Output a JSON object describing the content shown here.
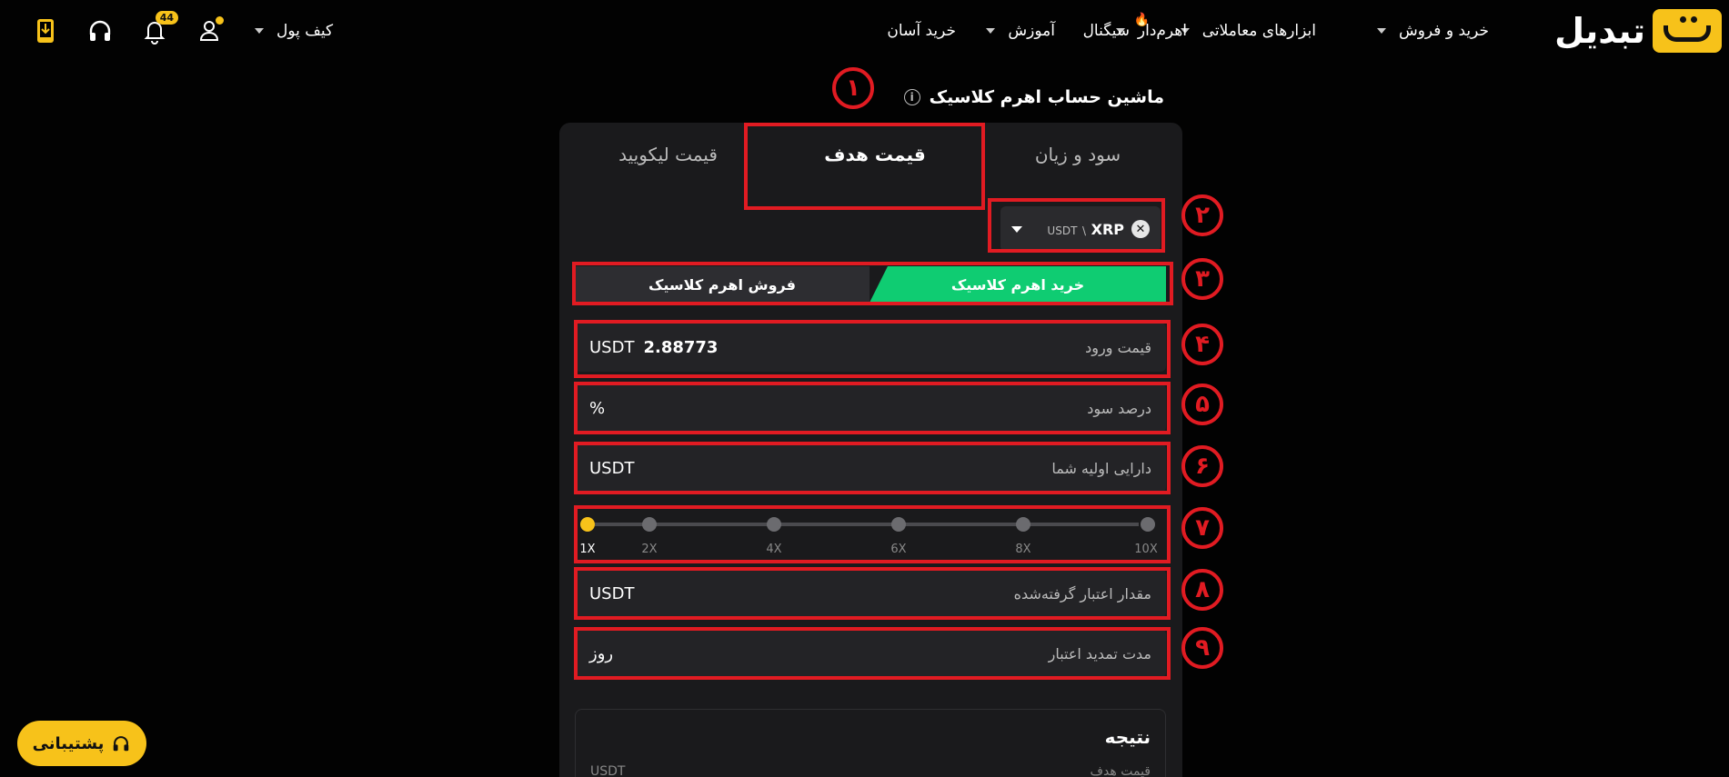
{
  "header": {
    "logo_text": "تبدیل",
    "nav": [
      {
        "label": "خرید و فروش",
        "dropdown": true
      },
      {
        "label": "ابزارهای معاملاتی",
        "dropdown": true
      },
      {
        "label": "اهرم‌دار",
        "dropdown": true,
        "hot": true
      },
      {
        "label": "سیگنال",
        "dropdown": false
      },
      {
        "label": "آموزش",
        "dropdown": true
      },
      {
        "label": "خرید آسان",
        "dropdown": false
      }
    ],
    "wallet_label": "کیف پول",
    "notification_count": "44",
    "icons": [
      "user-icon",
      "bell-icon",
      "headset-icon",
      "app-download-icon"
    ]
  },
  "title": "ماشین حساب اهرم کلاسیک",
  "tabs": [
    {
      "label": "سود و زیان",
      "active": false
    },
    {
      "label": "قیمت هدف",
      "active": true
    },
    {
      "label": "قیمت لیکویید",
      "active": false
    }
  ],
  "pair": {
    "base": "XRP",
    "separator": "\\",
    "quote": "USDT"
  },
  "side": {
    "buy_label": "خرید اهرم کلاسیک",
    "sell_label": "فروش اهرم کلاسیک"
  },
  "fields": {
    "entry_price": {
      "label": "قیمت ورود",
      "value": "2.88773",
      "unit": "USDT"
    },
    "profit_percent": {
      "label": "درصد سود",
      "unit": "%"
    },
    "initial_asset": {
      "label": "دارایی اولیه شما",
      "unit": "USDT"
    },
    "borrowed_amount": {
      "label": "مقدار اعتبار گرفته‌شده",
      "unit": "USDT"
    },
    "extension_duration": {
      "label": "مدت تمدید اعتبار",
      "unit": "روز"
    }
  },
  "leverage": {
    "ticks": [
      "1X",
      "2X",
      "4X",
      "6X",
      "8X",
      "10X"
    ],
    "selected": "1X"
  },
  "result": {
    "title": "نتیجه",
    "target_label": "قیمت هدف",
    "unit": "USDT"
  },
  "annotations": [
    "۱",
    "۲",
    "۳",
    "۴",
    "۵",
    "۶",
    "۷",
    "۸",
    "۹"
  ],
  "support_label": "پشتیبانی",
  "colors": {
    "accent": "#f7c21a",
    "buy": "#0fcc72",
    "annotation": "#e11b22",
    "background": "#020202",
    "card": "#1a1a1c"
  }
}
